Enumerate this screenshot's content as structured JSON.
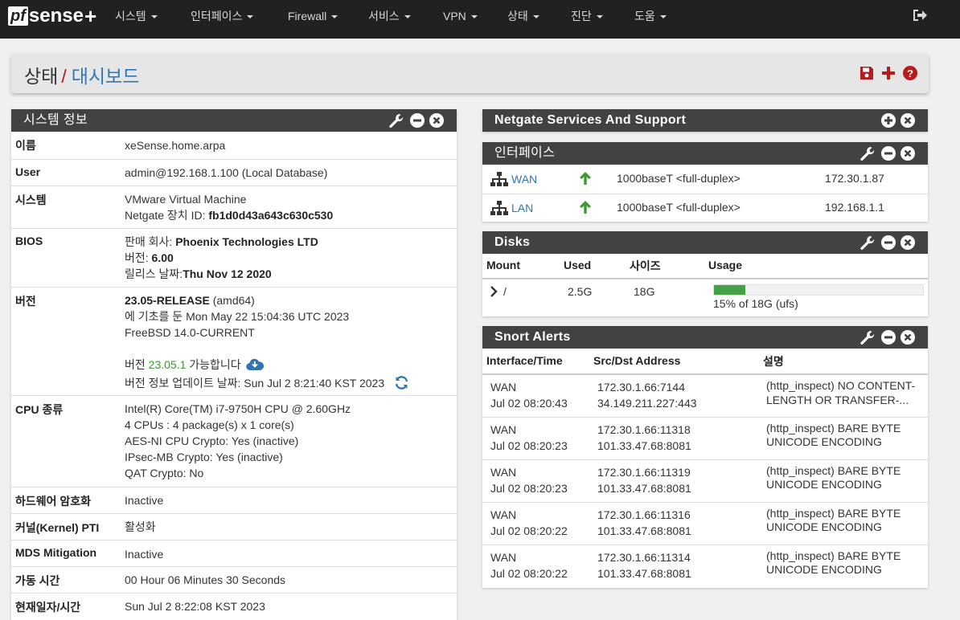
{
  "nav": {
    "logo_box": "pf",
    "logo_text": "sense",
    "logo_plus": "+",
    "items": [
      "시스템",
      "인터페이스",
      "Firewall",
      "서비스",
      "VPN",
      "상태",
      "진단",
      "도움"
    ]
  },
  "breadcrumb": {
    "parent": "상태",
    "sep": "/",
    "current": "대시보드"
  },
  "system_info": {
    "title": "시스템 정보",
    "rows": [
      {
        "label": "이름",
        "lines": [
          "xeSense.home.arpa"
        ]
      },
      {
        "label": "User",
        "lines": [
          "admin@192.168.1.100 (Local Database)"
        ]
      },
      {
        "label": "시스템",
        "line1": "VMware Virtual Machine",
        "line2_prefix": "Netgate 장치 ID: ",
        "line2_bold": "fb1d0d43a643c630c530"
      },
      {
        "label": "BIOS",
        "vendor_prefix": "판매 회사: ",
        "vendor": "Phoenix Technologies LTD",
        "version_prefix": "버전: ",
        "version": "6.00",
        "release_prefix": "릴리스 날짜:",
        "release": "Thu Nov 12 2020"
      },
      {
        "label": "버전",
        "release_bold": "23.05-RELEASE",
        "release_arch": " (amd64)",
        "built": "에 기초를 둔 Mon May 22 15:04:36 UTC 2023",
        "os": "FreeBSD 14.0-CURRENT",
        "avail_prefix": "버전 ",
        "avail_version": "23.05.1",
        "avail_suffix": " 가능합니다",
        "update_check": "버전 정보 업데이트 날짜: Sun Jul 2 8:21:40 KST 2023"
      },
      {
        "label": "CPU 종류",
        "lines": [
          "Intel(R) Core(TM) i7-9750H CPU @ 2.60GHz",
          "4 CPUs : 4 package(s) x 1 core(s)",
          "AES-NI CPU Crypto: Yes (inactive)",
          "IPsec-MB Crypto: Yes (inactive)",
          "QAT Crypto: No"
        ]
      },
      {
        "label": "하드웨어 암호화",
        "lines": [
          "Inactive"
        ]
      },
      {
        "label": "커널(Kernel) PTI",
        "lines": [
          "활성화"
        ]
      },
      {
        "label": "MDS Mitigation",
        "lines": [
          "Inactive"
        ]
      },
      {
        "label": "가동 시간",
        "lines": [
          "00 Hour 06 Minutes 30 Seconds"
        ]
      },
      {
        "label": "현재일자/시간",
        "lines": [
          "Sun Jul 2 8:22:08 KST 2023"
        ]
      }
    ]
  },
  "netgate": {
    "title": "Netgate Services And Support"
  },
  "interfaces": {
    "title": "인터페이스",
    "rows": [
      {
        "name": "WAN",
        "media": "1000baseT <full-duplex>",
        "ip": "172.30.1.87",
        "status": "up"
      },
      {
        "name": "LAN",
        "media": "1000baseT <full-duplex>",
        "ip": "192.168.1.1",
        "status": "up"
      }
    ]
  },
  "disks": {
    "title": "Disks",
    "headers": [
      "Mount",
      "Used",
      "사이즈",
      "Usage"
    ],
    "rows": [
      {
        "mount": "/",
        "used": "2.5G",
        "size": "18G",
        "usage_pct": 15,
        "usage_text": "15% of 18G (ufs)"
      }
    ]
  },
  "snort": {
    "title": "Snort Alerts",
    "headers": [
      "Interface/Time",
      "Src/Dst Address",
      "설명"
    ],
    "rows": [
      {
        "iface": "WAN",
        "time": "Jul 02 08:20:43",
        "src": "172.30.1.66:7144",
        "dst": "34.149.211.227:443",
        "desc1": "(http_inspect) NO CONTENT-",
        "desc2": "LENGTH OR TRANSFER-..."
      },
      {
        "iface": "WAN",
        "time": "Jul 02 08:20:23",
        "src": "172.30.1.66:11318",
        "dst": "101.33.47.68:8081",
        "desc1": "(http_inspect) BARE BYTE",
        "desc2": "UNICODE ENCODING"
      },
      {
        "iface": "WAN",
        "time": "Jul 02 08:20:23",
        "src": "172.30.1.66:11319",
        "dst": "101.33.47.68:8081",
        "desc1": "(http_inspect) BARE BYTE",
        "desc2": "UNICODE ENCODING"
      },
      {
        "iface": "WAN",
        "time": "Jul 02 08:20:22",
        "src": "172.30.1.66:11316",
        "dst": "101.33.47.68:8081",
        "desc1": "(http_inspect) BARE BYTE",
        "desc2": "UNICODE ENCODING"
      },
      {
        "iface": "WAN",
        "time": "Jul 02 08:20:22",
        "src": "172.30.1.66:11314",
        "dst": "101.33.47.68:8081",
        "desc1": "(http_inspect) BARE BYTE",
        "desc2": "UNICODE ENCODING"
      }
    ]
  },
  "colors": {
    "navbar": "#212121",
    "panel_head": "#424242",
    "link": "#3276b1",
    "accent_red": "#b71c1c",
    "green": "#3c9a2e"
  },
  "icons": [
    "wrench-icon",
    "minus-circle-icon",
    "close-circle-icon",
    "plus-circle-icon",
    "save-icon",
    "plus-icon",
    "help-icon",
    "logout-icon",
    "network-icon",
    "arrow-up-icon",
    "cloud-download-icon",
    "refresh-icon",
    "chevron-right-icon"
  ]
}
